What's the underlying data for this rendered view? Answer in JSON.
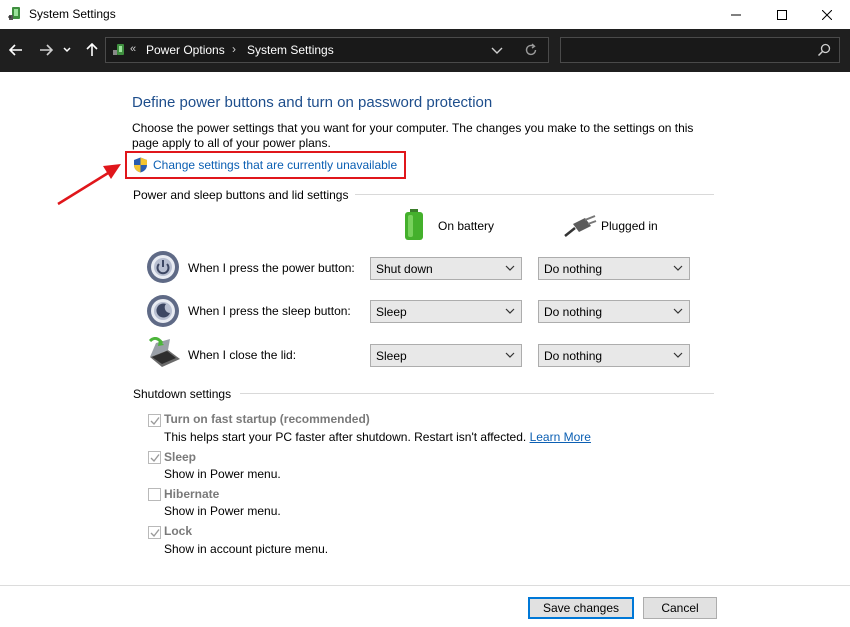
{
  "window": {
    "title": "System Settings",
    "controls": [
      "minimize-icon",
      "maximize-icon",
      "close-icon"
    ]
  },
  "navbar": {
    "breadcrumb_overflow": "«",
    "breadcrumbs": [
      "Power Options",
      "System Settings"
    ],
    "separator": "›",
    "search_placeholder": ""
  },
  "page": {
    "heading": "Define power buttons and turn on password protection",
    "description": "Choose the power settings that you want for your computer. The changes you make to the settings on this page apply to all of your power plans.",
    "change_link": "Change settings that are currently unavailable"
  },
  "buttons_section": {
    "title": "Power and sleep buttons and lid settings",
    "columns": [
      "On battery",
      "Plugged in"
    ],
    "rows": [
      {
        "label": "When I press the power button:",
        "icon": "power-button-icon",
        "on_battery": "Shut down",
        "plugged_in": "Do nothing"
      },
      {
        "label": "When I press the sleep button:",
        "icon": "sleep-button-icon",
        "on_battery": "Sleep",
        "plugged_in": "Do nothing"
      },
      {
        "label": "When I close the lid:",
        "icon": "laptop-lid-icon",
        "on_battery": "Sleep",
        "plugged_in": "Do nothing"
      }
    ]
  },
  "shutdown_section": {
    "title": "Shutdown settings",
    "options": [
      {
        "label": "Turn on fast startup (recommended)",
        "checked": true,
        "desc": "This helps start your PC faster after shutdown. Restart isn't affected.",
        "link": "Learn More"
      },
      {
        "label": "Sleep",
        "checked": true,
        "desc": "Show in Power menu.",
        "link": ""
      },
      {
        "label": "Hibernate",
        "checked": false,
        "desc": "Show in Power menu.",
        "link": ""
      },
      {
        "label": "Lock",
        "checked": true,
        "desc": "Show in account picture menu.",
        "link": ""
      }
    ]
  },
  "footer": {
    "save": "Save changes",
    "cancel": "Cancel"
  },
  "colors": {
    "heading": "#1e4e8c",
    "link": "#0b5fb3",
    "highlight_box": "#e0161b",
    "navbar_bg": "#1f1f1f"
  }
}
